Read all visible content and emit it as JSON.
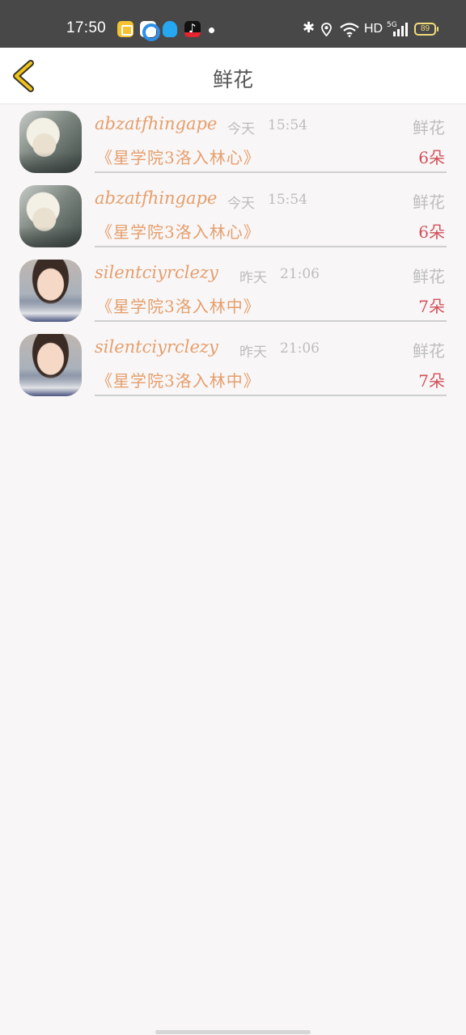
{
  "status_bar": {
    "time": "17:50",
    "network_hd": "HD",
    "network_5g": "5G",
    "battery": "89",
    "app_icons": [
      "reader-app-icon",
      "browser-app-icon",
      "qq-icon",
      "tiktok-icon"
    ]
  },
  "header": {
    "title": "鲜花",
    "back_icon": "chevron-left-icon",
    "accent_color": "#f0c419"
  },
  "records": [
    {
      "username": "abzatfhingape",
      "day": "今天",
      "clock": "15:54",
      "type": "鲜花",
      "book": "《星学院3洛入林心》",
      "count": "6朵",
      "avatar": "anime-avatar"
    },
    {
      "username": "abzatfhingape",
      "day": "今天",
      "clock": "15:54",
      "type": "鲜花",
      "book": "《星学院3洛入林心》",
      "count": "6朵",
      "avatar": "anime-avatar"
    },
    {
      "username": "silentciyrclezy",
      "day": "昨天",
      "clock": "21:06",
      "type": "鲜花",
      "book": "《星学院3洛入林中》",
      "count": "7朵",
      "avatar": "child-photo-avatar"
    },
    {
      "username": "silentciyrclezy",
      "day": "昨天",
      "clock": "21:06",
      "type": "鲜花",
      "book": "《星学院3洛入林中》",
      "count": "7朵",
      "avatar": "child-photo-avatar"
    }
  ],
  "colors": {
    "username": "#e59f6c",
    "count": "#d2505a",
    "meta": "#bdbdbd",
    "background": "#f8f6f7"
  }
}
